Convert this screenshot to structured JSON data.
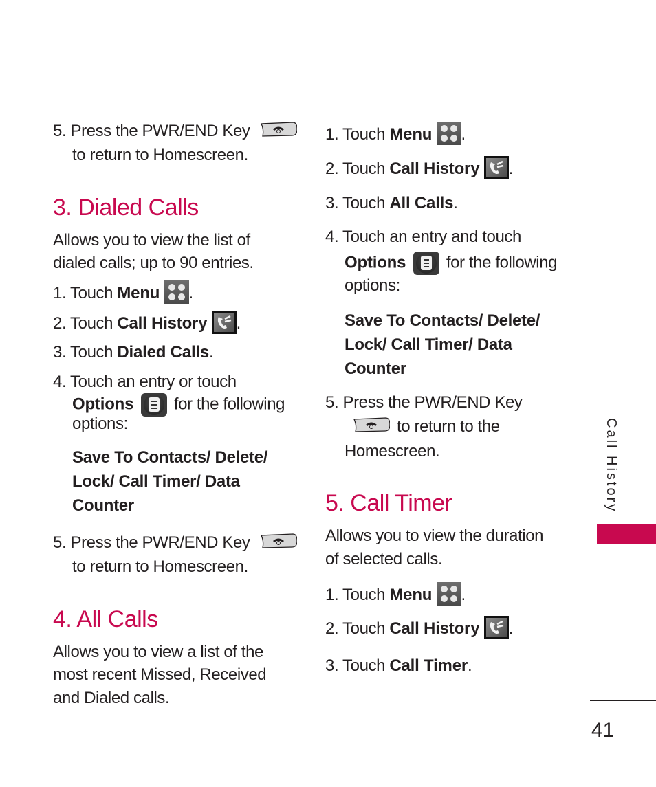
{
  "accent_color": "#c8094f",
  "page_number": "41",
  "side_tab_label": "Call History",
  "icons": {
    "menu": "menu-grid-icon",
    "call_history": "call-history-icon",
    "options": "options-list-icon",
    "pwr_end_key": "end-call-key-icon"
  },
  "left": {
    "prev_step": {
      "num": "5. Press the PWR/END Key",
      "cont": "to return to Homescreen."
    },
    "dialed_calls": {
      "heading": "3. Dialed Calls",
      "desc": [
        "Allows you to view the list of",
        "dialed calls; up to 90 entries."
      ],
      "step1": {
        "prefix": "1. Touch ",
        "bold": "Menu",
        "suffix": "."
      },
      "step2": {
        "prefix": "2. Touch ",
        "bold": "Call History",
        "suffix": "."
      },
      "step3": {
        "prefix": "3. Touch ",
        "bold": "Dialed Calls",
        "suffix": "."
      },
      "step4": {
        "line1": "4. Touch an entry or touch",
        "bold": "Options",
        "after_icon": "for the following",
        "line3": "options:"
      },
      "options_list": [
        "Save To Contacts/ Delete/",
        "Lock/ Call Timer/ Data",
        "Counter"
      ],
      "step5": {
        "num": "5. Press the PWR/END Key",
        "cont": "to return to Homescreen."
      }
    },
    "all_calls": {
      "heading": "4. All Calls",
      "desc": [
        "Allows you to view a list of the",
        "most recent Missed, Received",
        "and Dialed calls."
      ]
    }
  },
  "right": {
    "all_calls_steps": {
      "step1": {
        "prefix": "1. Touch ",
        "bold": "Menu",
        "suffix": "."
      },
      "step2": {
        "prefix": "2. Touch ",
        "bold": "Call History",
        "suffix": "."
      },
      "step3": {
        "prefix": "3. Touch ",
        "bold": "All Calls",
        "suffix": "."
      },
      "step4": {
        "line1": "4. Touch an entry and touch",
        "bold": "Options",
        "after_icon": "for the following",
        "line3": "options:"
      },
      "options_list": [
        "Save To Contacts/ Delete/",
        "Lock/ Call Timer/ Data",
        "Counter"
      ],
      "step5": {
        "num": "5. Press the PWR/END Key",
        "cont": "to return to the",
        "cont2": "Homescreen."
      }
    },
    "call_timer": {
      "heading": "5. Call Timer",
      "desc": [
        "Allows you to view the duration",
        "of selected calls."
      ],
      "step1": {
        "prefix": "1. Touch ",
        "bold": "Menu",
        "suffix": "."
      },
      "step2": {
        "prefix": "2. Touch ",
        "bold": "Call History",
        "suffix": "."
      },
      "step3": {
        "prefix": "3. Touch ",
        "bold": "Call Timer",
        "suffix": "."
      }
    }
  }
}
